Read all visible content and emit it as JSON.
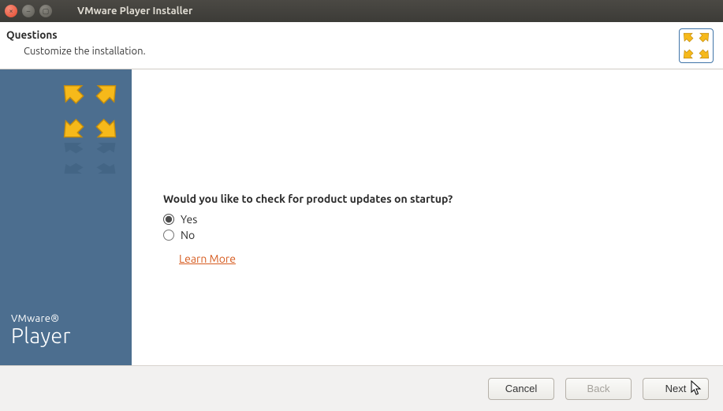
{
  "titlebar": {
    "title": "VMware Player Installer"
  },
  "header": {
    "title": "Questions",
    "subtitle": "Customize the installation."
  },
  "sidebar": {
    "brand_small": "VMware®",
    "brand_large": "Player"
  },
  "content": {
    "question": "Would you like to check for product updates on startup?",
    "options": {
      "yes": "Yes",
      "no": "No",
      "selected": "yes"
    },
    "learn_more": "Learn More"
  },
  "footer": {
    "cancel": "Cancel",
    "back": "Back",
    "next": "Next"
  },
  "colors": {
    "sidebar_bg": "#4c6e8f",
    "logo_yellow": "#f6b91a",
    "link": "#d65b1f"
  }
}
